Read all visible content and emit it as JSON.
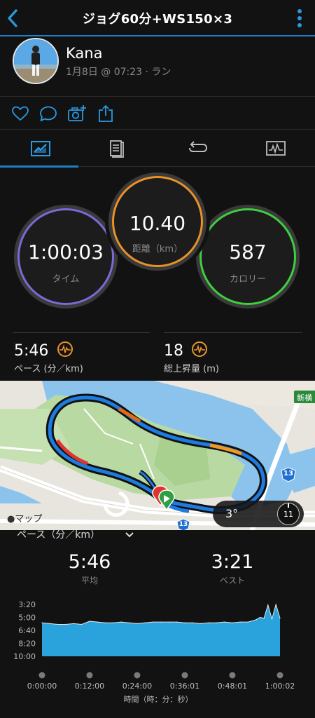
{
  "header": {
    "title": "ジョグ60分+WS150×3"
  },
  "profile": {
    "name": "Kana",
    "meta": "1月8日 @ 07:23 · ラン"
  },
  "actions": [
    "heart-icon",
    "comment-icon",
    "add-photo-icon",
    "share-icon"
  ],
  "tabs": [
    "summary",
    "details",
    "laps",
    "charts"
  ],
  "rings": {
    "time": {
      "value": "1:00:03",
      "label": "タイム",
      "color": "#7a6bd6"
    },
    "distance": {
      "value": "10.40",
      "label": "距離（km）",
      "color": "#e8932a"
    },
    "calories": {
      "value": "587",
      "label": "カロリー",
      "color": "#3fcf3f"
    }
  },
  "stats": {
    "pace": {
      "value": "5:46",
      "label": "ペース (分／km)"
    },
    "ascent": {
      "value": "18",
      "label": "総上昇量 (m)"
    }
  },
  "map": {
    "attribution": "マップ",
    "road_badge": "13",
    "place": "新横",
    "temperature": "3°",
    "wind_speed": "11"
  },
  "pace_section": {
    "selector": "ペース（分／km）",
    "avg_value": "5:46",
    "avg_label": "平均",
    "best_value": "3:21",
    "best_label": "ベスト"
  },
  "chart_data": {
    "type": "area",
    "y_ticks": [
      "3:20",
      "5:00",
      "6:40",
      "8:20",
      "10:00"
    ],
    "x_ticks": [
      "0:00:00",
      "0:12:00",
      "0:24:00",
      "0:36:01",
      "0:48:01",
      "1:00:02"
    ],
    "xlabel": "時間（時：分：秒）",
    "color": "#2aa3dc",
    "series": [
      {
        "x": [
          "0:00:00",
          "0:02:00",
          "0:04:00",
          "0:06:00",
          "0:08:00",
          "0:10:00",
          "0:12:00",
          "0:14:00",
          "0:16:00",
          "0:18:00",
          "0:20:00",
          "0:22:00",
          "0:24:00",
          "0:26:00",
          "0:28:00",
          "0:30:00",
          "0:32:00",
          "0:34:00",
          "0:36:01",
          "0:38:00",
          "0:40:00",
          "0:42:00",
          "0:44:00",
          "0:46:00",
          "0:48:01",
          "0:50:00",
          "0:52:00",
          "0:54:00",
          "0:55:00",
          "0:56:00",
          "0:57:00",
          "0:58:00",
          "0:59:00",
          "1:00:02"
        ],
        "values": [
          5.7,
          5.8,
          5.9,
          5.9,
          5.8,
          5.9,
          5.5,
          5.6,
          5.7,
          5.7,
          5.6,
          5.7,
          5.8,
          5.7,
          5.6,
          5.6,
          5.6,
          5.6,
          5.7,
          5.7,
          5.8,
          5.7,
          5.7,
          5.6,
          5.7,
          5.6,
          5.6,
          5.3,
          5.0,
          5.1,
          3.4,
          5.2,
          3.35,
          5.1
        ]
      }
    ]
  }
}
